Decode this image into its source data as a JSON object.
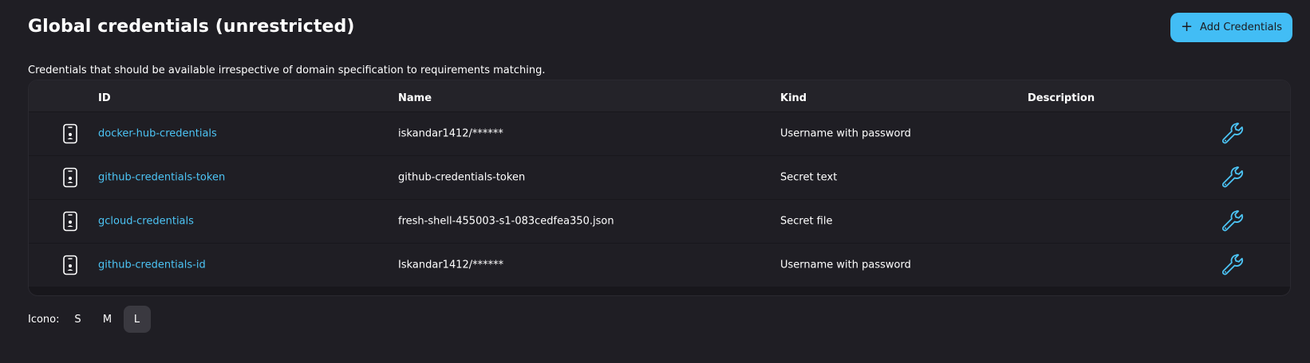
{
  "header": {
    "title": "Global credentials (unrestricted)",
    "add_button": {
      "icon": "plus-icon",
      "label": "Add Credentials"
    }
  },
  "description": "Credentials that should be available irrespective of domain specification to requirements matching.",
  "table": {
    "columns": [
      "ID",
      "Name",
      "Kind",
      "Description"
    ],
    "rows": [
      {
        "icon": "credential-card-icon",
        "id": "docker-hub-credentials",
        "name": "iskandar1412/******",
        "kind": "Username with password",
        "description": "",
        "action_icon": "wrench-icon"
      },
      {
        "icon": "credential-card-icon",
        "id": "github-credentials-token",
        "name": "github-credentials-token",
        "kind": "Secret text",
        "description": "",
        "action_icon": "wrench-icon"
      },
      {
        "icon": "credential-card-icon",
        "id": "gcloud-credentials",
        "name": "fresh-shell-455003-s1-083cedfea350.json",
        "kind": "Secret file",
        "description": "",
        "action_icon": "wrench-icon"
      },
      {
        "icon": "credential-card-icon",
        "id": "github-credentials-id",
        "name": "Iskandar1412/******",
        "kind": "Username with password",
        "description": "",
        "action_icon": "wrench-icon"
      }
    ]
  },
  "icon_size": {
    "label": "Icono:",
    "options": [
      "S",
      "M",
      "L"
    ],
    "selected": "L"
  },
  "colors": {
    "background": "#1f1e24",
    "accent": "#42bdf5",
    "link": "#4cc4f5"
  }
}
